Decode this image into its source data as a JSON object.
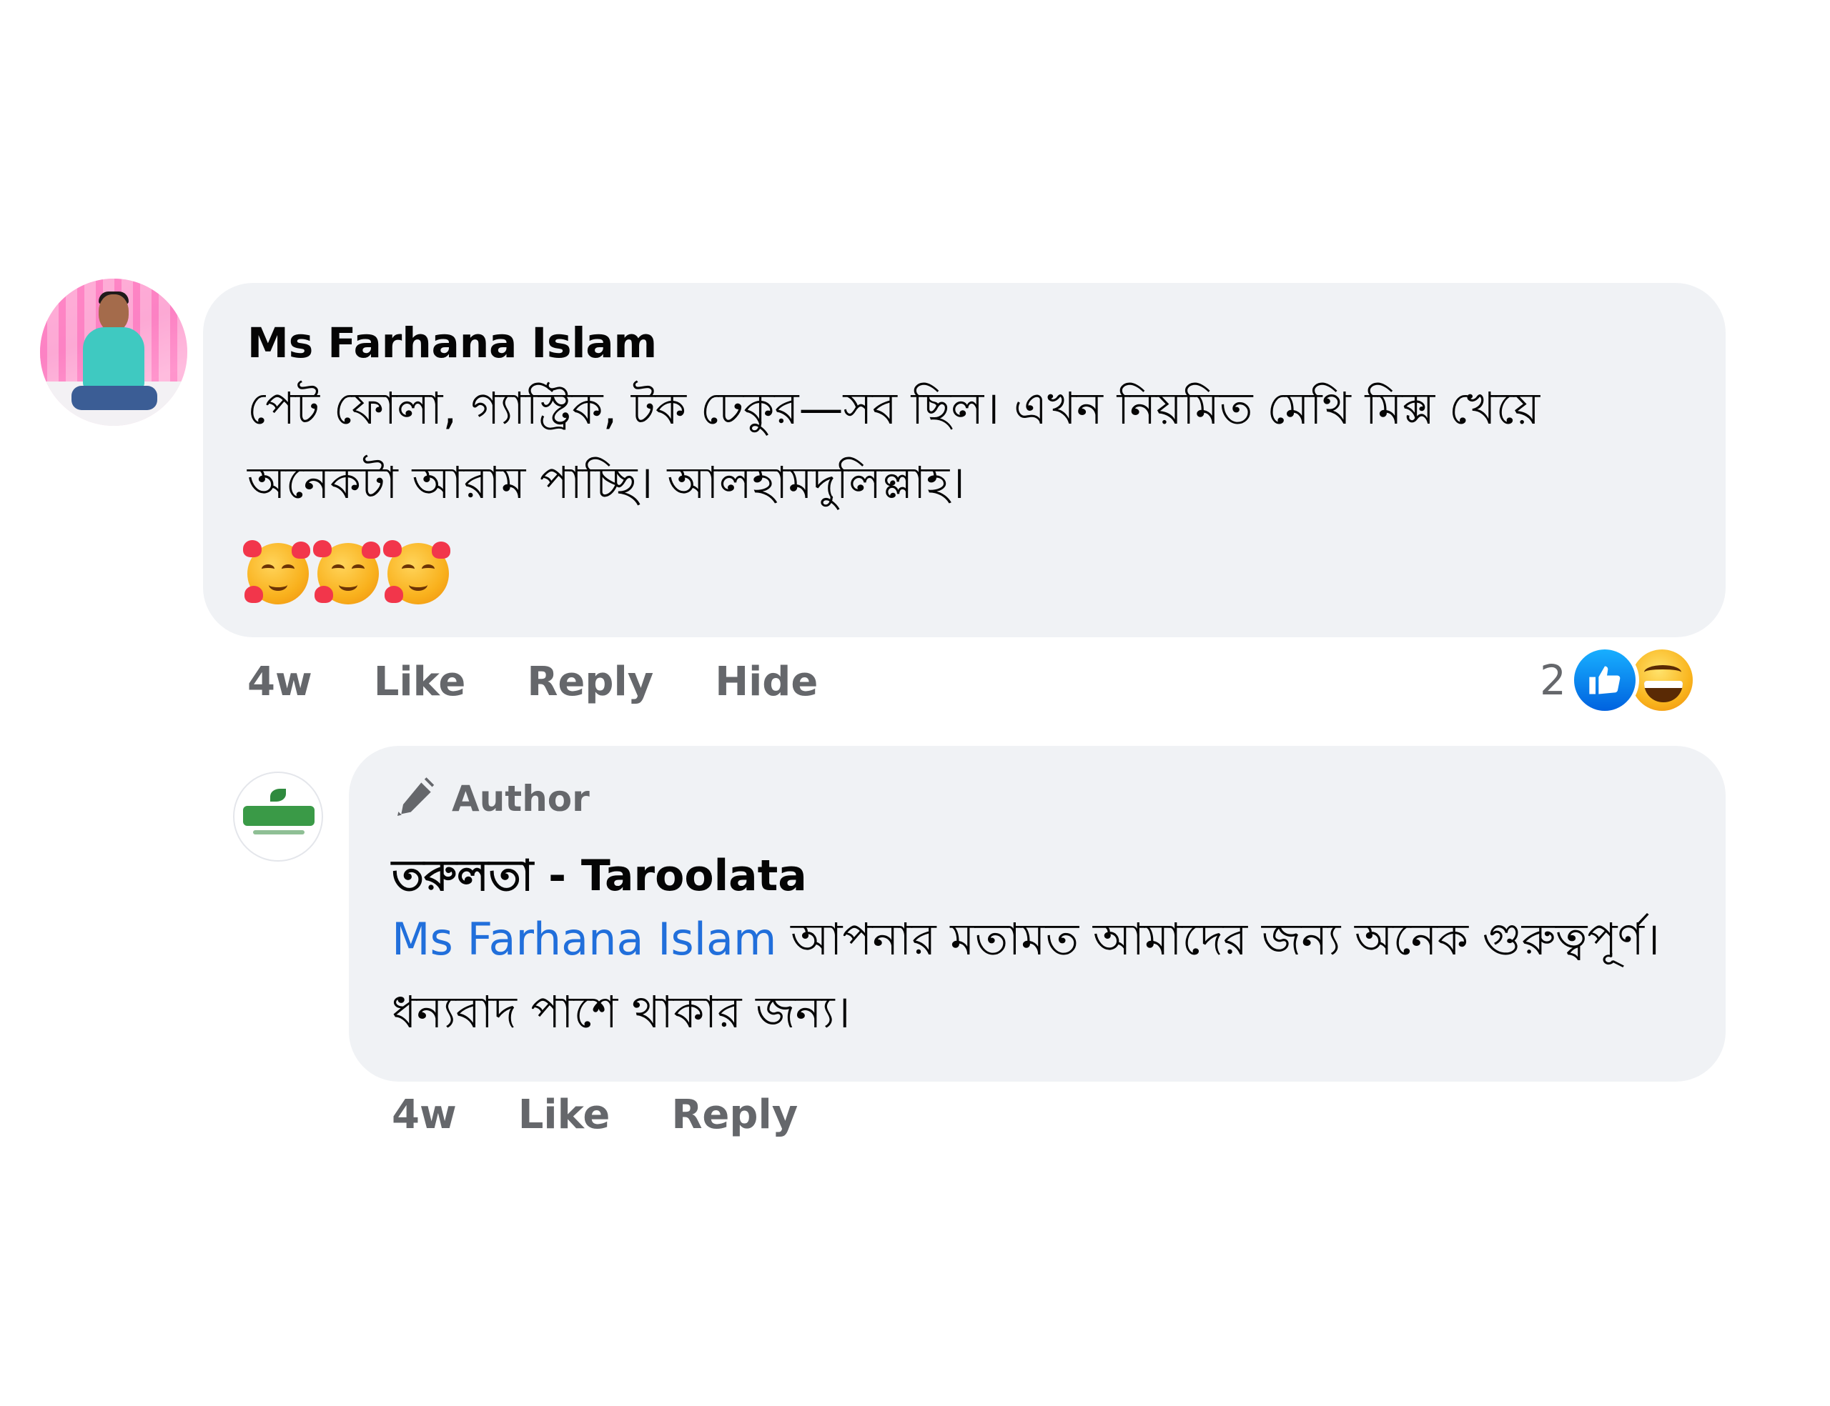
{
  "comment": {
    "author": "Ms Farhana Islam",
    "text": "পেট ফোলা, গ্যাস্ট্রিক, টক ঢেকুর—সব ছিল। এখন নিয়মিত মেথি মিক্স খেয়ে অনেকটা আরাম পাচ্ছি। আলহামদুলিল্লাহ।",
    "emojis": [
      "smiling-face-with-hearts",
      "smiling-face-with-hearts",
      "smiling-face-with-hearts"
    ],
    "time": "4w",
    "actions": {
      "like": "Like",
      "reply": "Reply",
      "hide": "Hide"
    },
    "reaction_count": "2",
    "reaction_icons": [
      "like",
      "haha"
    ]
  },
  "reply": {
    "badge": "Author",
    "author": "তরুলতা - Taroolata",
    "mention": "Ms Farhana Islam",
    "text": " আপনার মতামত আমাদের জন্য অনেক গুরুত্বপূর্ণ। ধন্যবাদ পাশে থাকার জন্য।",
    "time": "4w",
    "actions": {
      "like": "Like",
      "reply": "Reply"
    }
  },
  "colors": {
    "bubble": "#f0f2f5",
    "meta_text": "#65676b",
    "mention": "#216fdb",
    "like_blue": "#0866ff"
  }
}
